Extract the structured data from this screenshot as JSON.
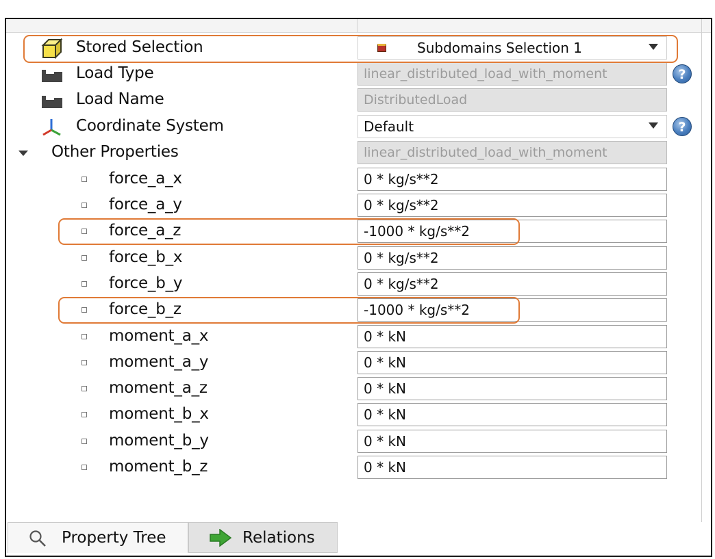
{
  "properties": {
    "stored_selection": {
      "label": "Stored Selection",
      "value": "Subdomains Selection 1",
      "icon": "cube-icon"
    },
    "load_type": {
      "label": "Load Type",
      "value": "linear_distributed_load_with_moment",
      "icon": "load-icon"
    },
    "load_name": {
      "label": "Load Name",
      "value": "DistributedLoad",
      "icon": "load-icon"
    },
    "coordinate_system": {
      "label": "Coordinate System",
      "value": "Default",
      "icon": "axes-icon"
    },
    "other_properties": {
      "label": "Other Properties",
      "value": "linear_distributed_load_with_moment"
    },
    "help_glyph": "?",
    "items": [
      {
        "label": "force_a_x",
        "value": "0 * kg/s**2"
      },
      {
        "label": "force_a_y",
        "value": "0 * kg/s**2"
      },
      {
        "label": "force_a_z",
        "value": "-1000 * kg/s**2"
      },
      {
        "label": "force_b_x",
        "value": "0 * kg/s**2"
      },
      {
        "label": "force_b_y",
        "value": "0 * kg/s**2"
      },
      {
        "label": "force_b_z",
        "value": "-1000 * kg/s**2"
      },
      {
        "label": "moment_a_x",
        "value": "0 * kN"
      },
      {
        "label": "moment_a_y",
        "value": "0 * kN"
      },
      {
        "label": "moment_a_z",
        "value": "0 * kN"
      },
      {
        "label": "moment_b_x",
        "value": "0 * kN"
      },
      {
        "label": "moment_b_y",
        "value": "0 * kN"
      },
      {
        "label": "moment_b_z",
        "value": "0 * kN"
      }
    ]
  },
  "tabs": [
    {
      "label": "Property Tree",
      "icon": "magnifier-icon",
      "active": true
    },
    {
      "label": "Relations",
      "icon": "green-arrow-icon",
      "active": false
    }
  ],
  "colors": {
    "highlight": "#e07a36",
    "help": "#4a7fbf",
    "arrow": "#3fa535"
  }
}
